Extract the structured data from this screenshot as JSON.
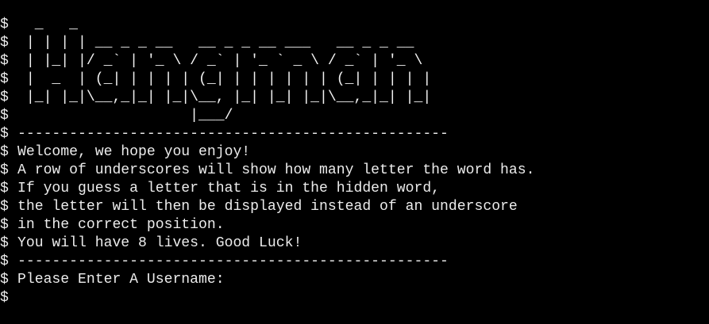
{
  "terminal": {
    "prompt": "$",
    "lines": [
      {
        "kind": "art",
        "text": "  _   _"
      },
      {
        "kind": "art",
        "text": " | | | | __ _ _ __   __ _ _ __ ___   __ _ _ __"
      },
      {
        "kind": "art",
        "text": " | |_| |/ _` | '_ \\ / _` | '_ ` _ \\ / _` | '_ \\"
      },
      {
        "kind": "art",
        "text": " |  _  | (_| | | | | (_| | | | | | | (_| | | | |"
      },
      {
        "kind": "art",
        "text": " |_| |_|\\__,_|_| |_|\\__, |_| |_| |_|\\__,_|_| |_|"
      },
      {
        "kind": "art",
        "text": "                    |___/"
      },
      {
        "kind": "text",
        "text": "--------------------------------------------------"
      },
      {
        "kind": "text",
        "text": "Welcome, we hope you enjoy!"
      },
      {
        "kind": "text",
        "text": "A row of underscores will show how many letter the word has."
      },
      {
        "kind": "text",
        "text": "If you guess a letter that is in the hidden word,"
      },
      {
        "kind": "text",
        "text": "the letter will then be displayed instead of an underscore"
      },
      {
        "kind": "text",
        "text": "in the correct position."
      },
      {
        "kind": "text",
        "text": "You will have 8 lives. Good Luck!"
      },
      {
        "kind": "text",
        "text": "--------------------------------------------------"
      },
      {
        "kind": "text",
        "text": "Please Enter A Username:"
      },
      {
        "kind": "input",
        "text": ""
      }
    ]
  },
  "colors": {
    "background": "#000000",
    "foreground": "#ececec"
  }
}
